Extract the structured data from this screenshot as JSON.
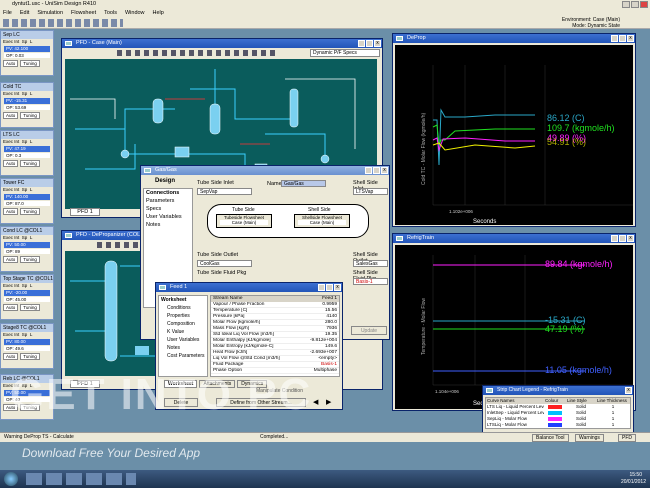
{
  "app": {
    "title": "dyntut1.usc - UniSim Design R410",
    "menu": [
      "File",
      "Edit",
      "Simulation",
      "Flowsheet",
      "Tools",
      "Window",
      "Help"
    ],
    "env_label": "Environment: Case (Main)",
    "mode_label": "Mode: Dynamic State"
  },
  "controllers": [
    {
      "title": "Sep LC",
      "pv": "PV: 42.100",
      "op": "OP: 0.03"
    },
    {
      "title": "Cold TC",
      "pv": "PV: -15.31",
      "op": "OP: 53.69"
    },
    {
      "title": "LTS LC",
      "pv": "PV: 47.19",
      "op": "OP: 0.3"
    },
    {
      "title": "Tower FC",
      "pv": "PV: 140.00",
      "op": "OP: 87.0"
    },
    {
      "title": "Cond LC @COL1",
      "pv": "PV: 50.00",
      "op": "OP: 89"
    },
    {
      "title": "Top Stage TC @COL1",
      "pv": "PV: -20.00",
      "op": "OP: 45.00"
    },
    {
      "title": "Stage8 TC @COL1",
      "pv": "PV: 80.00",
      "op": "OP: 49.6"
    },
    {
      "title": "Reb LC @COL1",
      "pv": "PV: 50.00",
      "op": "OP: 40"
    }
  ],
  "ctrl_labels": {
    "exec": "Exec Int",
    "sp": "Sp",
    "l": "L",
    "auto": "Auto",
    "tuning": "Tuning"
  },
  "pfd_main": {
    "title": "PFD - Case (Main)",
    "tab": "PFD 1",
    "dropdown": "Dynamic P/F Specs"
  },
  "pfd_col": {
    "title": "PFD - DePropanizer (COL1)",
    "tab": "PFD 1"
  },
  "gasgas": {
    "title": "Gas/Gas",
    "design_tab": "Design",
    "nav": [
      "Connections",
      "Parameters",
      "Specs",
      "User Variables",
      "Notes"
    ],
    "tube_inlet_label": "Tube Side Inlet",
    "tube_inlet": "SepVap",
    "name_label": "Name",
    "name": "Gas/Gas",
    "shell_inlet_label": "Shell Side Inlet",
    "shell_inlet": "LTSVap",
    "tube_side": "Tube Side",
    "tube_flowsheet": "Tubeside Flowsheet",
    "tube_case": "Case (Main)",
    "shell_side": "Shell Side",
    "shell_flowsheet": "Shellside Flowsheet",
    "shell_case": "Case (Main)",
    "tube_outlet_label": "Tube Side Outlet",
    "tube_outlet": "CoolGas",
    "shell_outlet_label": "Shell Side Outlet",
    "shell_outlet": "SalesGas",
    "tube_plug_label": "Tube Side Fluid Pkg",
    "shell_plug_label": "Shell Side Fluid Pkg",
    "plug_value": "Basis-1",
    "update": "Update"
  },
  "feed": {
    "title": "Feed 1",
    "nav": [
      "Worksheet",
      "Conditions",
      "Properties",
      "Composition",
      "K Value",
      "User Variables",
      "Notes",
      "Cost Parameters"
    ],
    "col_header": [
      "Stream Name",
      "Feed 1"
    ],
    "rows": [
      [
        "Vapour / Phase Fraction",
        "0.9959"
      ],
      [
        "Temperature [C]",
        "15.56"
      ],
      [
        "Pressure [kPa]",
        "4140"
      ],
      [
        "Molar Flow [kgmole/h]",
        "280.0"
      ],
      [
        "Mass Flow [kg/h]",
        "7936"
      ],
      [
        "Std Ideal Liq Vol Flow [m3/h]",
        "19.35"
      ],
      [
        "Molar Enthalpy [kJ/kgmole]",
        "-9.812e+004"
      ],
      [
        "Molar Entropy [kJ/kgmole-C]",
        "149.6"
      ],
      [
        "Heat Flow [kJ/h]",
        "-2.693e+007"
      ],
      [
        "Liq Vol Flow @Std Cond [m3/h]",
        "<empty>"
      ],
      [
        "Fluid Package",
        "Basis-1"
      ],
      [
        "Phase Option",
        "Multiphase"
      ]
    ],
    "tabs": [
      "Worksheet",
      "Attachments",
      "Dynamics"
    ],
    "delete": "Delete",
    "define": "Define from Other Stream...",
    "manipulate": "Manipulate Condition"
  },
  "deprop": {
    "title": "DeProp",
    "ylabel": "Cold TC - Molar Flow (kgmole/h)",
    "xlabel": "Seconds",
    "xtick": "1.102e+006",
    "v1": "86.12 (C)",
    "v2": "109.7 (kgmole/h)",
    "v3": "49.89 (%)",
    "v4": "54.91 (%)"
  },
  "refrig": {
    "title": "RefrigTrain",
    "ylabel": "Temperature - Molar Flow",
    "xlabel": "Seconds",
    "xtick1": "1.104e+006",
    "xtick2": "1.104e+006",
    "v1": "89.84 (kgmole/h)",
    "v2": "-15.31 (C)",
    "v3": "47.19 (%)",
    "v4": "11.05 (kgmole/h)"
  },
  "legend": {
    "title": "Strip Chart Legend - RefrigTrain",
    "headers": [
      "Curve Names",
      "Colour",
      "Line Style",
      "Line Thickness"
    ],
    "rows": [
      [
        "LTS Liq - Liquid Percent Level",
        "#ff2020",
        "Solid",
        "1"
      ],
      [
        "InletSep - Liquid Percent Level",
        "#00c0ff",
        "Solid",
        "1"
      ],
      [
        "SepLiq - Molar Flow",
        "#ff20ff",
        "Solid",
        "1"
      ],
      [
        "LTSLiq - Molar Flow",
        "#2040ff",
        "Solid",
        "1"
      ]
    ]
  },
  "status": {
    "left": "Warning  DeProp TS - Calculate",
    "completed": "Completed...",
    "balance": "Balance Tool",
    "warnings": "Warnings",
    "pfd": "PFD"
  },
  "taskbar": {
    "time": "15:50",
    "date": "20/01/2012"
  },
  "watermark": {
    "line1": "GET INTO PC",
    "line2": "Download Free Your Desired App"
  },
  "colors": {
    "cyan": "#2aa8c8",
    "yellow": "#f0f000",
    "magenta": "#ff20ff",
    "green": "#20e020",
    "blue": "#4060ff"
  }
}
